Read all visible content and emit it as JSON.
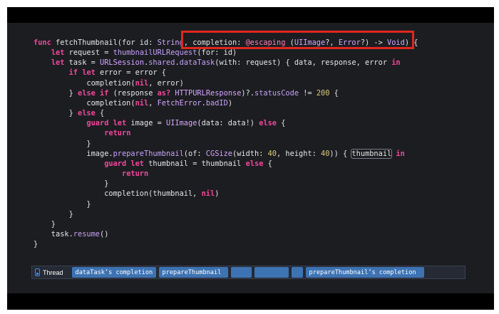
{
  "code": {
    "lines": [
      "func fetchThumbnail(for id: String, completion: @escaping (UIImage?, Error?) -> Void) {",
      "    let request = thumbnailURLRequest(for: id)",
      "    let task = URLSession.shared.dataTask(with: request) { data, response, error in",
      "        if let error = error {",
      "            completion(nil, error)",
      "        } else if (response as? HTTPURLResponse)?.statusCode != 200 {",
      "            completion(nil, FetchError.badID)",
      "        } else {",
      "            guard let image = UIImage(data: data!) else {",
      "                return",
      "            }",
      "            image.prepareThumbnail(of: CGSize(width: 40, height: 40)) { thumbnail in",
      "                guard let thumbnail = thumbnail else {",
      "                    return",
      "                }",
      "                completion(thumbnail, nil)",
      "            }",
      "        }",
      "    }",
      "    task.resume()",
      "}"
    ]
  },
  "highlight": {
    "color": "#e0271e"
  },
  "thread_bar": {
    "icon": "thread-icon",
    "label": "Thread",
    "segments": [
      {
        "text": "dataTask’s completion",
        "width": 118
      },
      {
        "text": "prepareThumbnail",
        "width": 97
      },
      {
        "text": "",
        "width": 29
      },
      {
        "text": "",
        "width": 48
      },
      {
        "text": "",
        "width": 16
      },
      {
        "text": "prepareThumbnail’s completion",
        "width": 166
      }
    ]
  },
  "colors": {
    "editor_background": "#1c1d21",
    "keyword": "#f1479a",
    "type": "#d5a5ff",
    "segment": "#3d73b3"
  }
}
